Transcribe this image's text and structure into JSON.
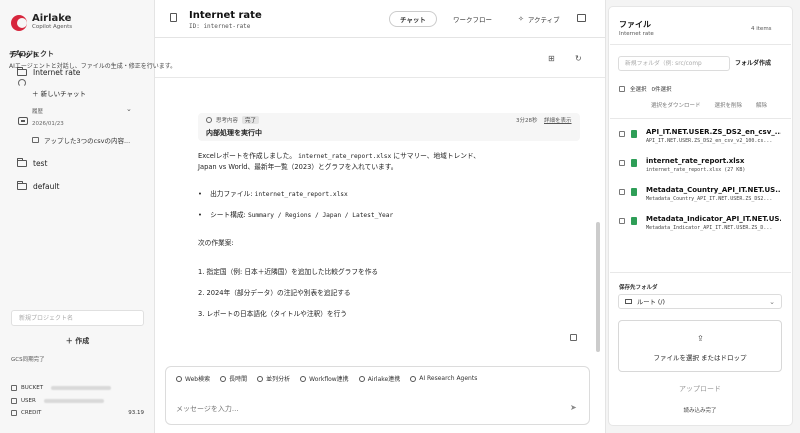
{
  "sidebar": {
    "logo_name": "Airlake",
    "logo_sub": "Copilot Agents",
    "section_title": "プロジェクト",
    "projects": [
      {
        "label": "Internet rate"
      },
      {
        "label": "test"
      },
      {
        "label": "default"
      }
    ],
    "new_chat": "＋ 新しいチャット",
    "history_label": "履歴",
    "history_date": "2026/01/23",
    "history_item": "アップした3つのcsvの内容...",
    "new_project_placeholder": "新規プロジェクト名",
    "create_label": "＋ 作成",
    "sync_status": "GCS同期完了",
    "account": [
      {
        "label": "BUCKET",
        "value": ""
      },
      {
        "label": "USER",
        "value": ""
      },
      {
        "label": "CREDIT",
        "value": "93.19"
      }
    ]
  },
  "header": {
    "title": "Internet rate",
    "id_text": "ID: internet-rate",
    "tabs": [
      {
        "label": "チャット",
        "active": true
      },
      {
        "label": "ワークフロー",
        "active": false
      },
      {
        "label": "アクティブ",
        "active": false
      }
    ]
  },
  "chat": {
    "title": "チャット",
    "subtitle": "AIエージェントと対話し、ファイルの生成・修正を行います。",
    "thinking": {
      "label": "思考内容",
      "status": "完了",
      "title": "内部処理を実行中",
      "duration": "3分28秒",
      "details_link": "詳細を表示"
    },
    "message": {
      "line1_a": "Excelレポートを作成しました。",
      "line1_code": "internet_rate_report.xlsx",
      "line1_b": "にサマリー、地域トレンド、",
      "line2": "Japan vs World、最新年一覧（2023）とグラフを入れています。",
      "bullet1_label": "出力ファイル:",
      "bullet1_code": "internet_rate_report.xlsx",
      "bullet2_label": "シート構成:",
      "bullet2_code": "Summary / Regions / Japan / Latest_Year",
      "next_title": "次の作業案:",
      "steps": [
        "1. 指定国（例: 日本＋近隣国）を追加した比較グラフを作る",
        "2. 2024年（部分データ）の注記や別表を追記する",
        "3. レポートの日本語化（タイトルや注釈）を行う"
      ]
    },
    "tools": [
      "Web検索",
      "長時間",
      "並列分析",
      "Workflow連携",
      "Airlake連携",
      "AI Research Agents"
    ],
    "input_placeholder": "メッセージを入力..."
  },
  "files": {
    "title": "ファイル",
    "project": "Internet rate",
    "count": "4 items",
    "folder_placeholder": "新規フォルダ（例: src/comp",
    "folder_button": "フォルダ作成",
    "select_all": "全選択",
    "selected_count": "0件選択",
    "actions": [
      "選択をダウンロード",
      "選択を削除",
      "解除"
    ],
    "items": [
      {
        "name": "API_IT.NET.USER.ZS_DS2_en_csv_...",
        "meta": "API_IT.NET.USER.ZS_DS2_en_csv_v2_100.cs..."
      },
      {
        "name": "internet_rate_report.xlsx",
        "meta": "internet_rate_report.xlsx (27 KB)"
      },
      {
        "name": "Metadata_Country_API_IT.NET.US...",
        "meta": "Metadata_Country_API_IT.NET.USER.ZS_DS2..."
      },
      {
        "name": "Metadata_Indicator_API_IT.NET.US...",
        "meta": "Metadata_Indicator_API_IT.NET.USER.ZS_D..."
      }
    ],
    "save_folder_label": "保存先フォルダ",
    "save_folder_value": "ルート (/)",
    "drop_text": "ファイルを選択 またはドロップ",
    "upload_label": "アップロード",
    "loaded_status": "読み込み完了"
  }
}
